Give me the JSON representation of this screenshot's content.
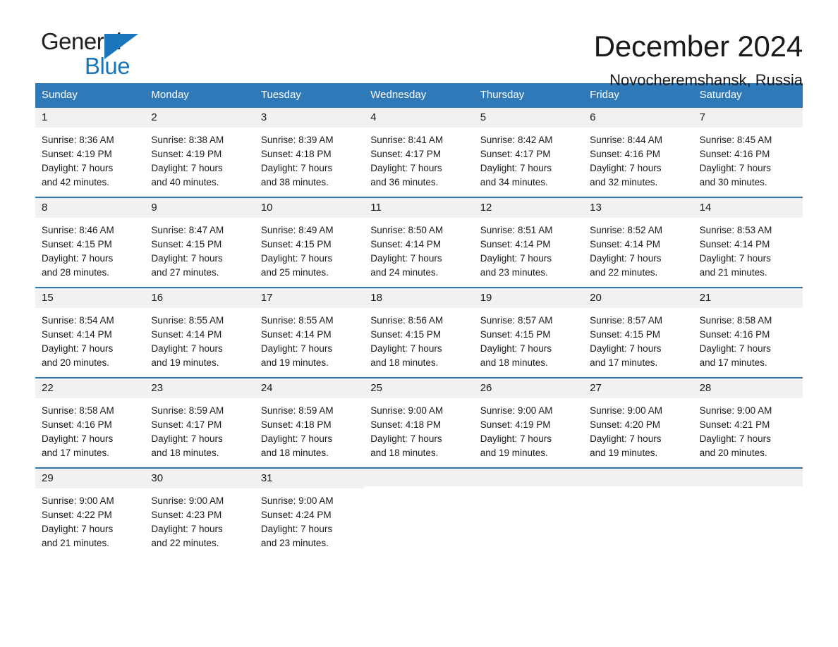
{
  "logo": {
    "word_one": "General",
    "word_two": "Blue",
    "triangle_icon": "triangle-icon",
    "brand_blue": "#1b75bb",
    "brand_dark": "#231f20"
  },
  "header": {
    "title": "December 2024",
    "location": "Novocheremshansk, Russia"
  },
  "theme": {
    "header_blue": "#3079b8",
    "row_divider_blue": "#2e75b6",
    "day_band_gray": "#f1f1f1",
    "text": "#1a1a1a"
  },
  "calendar": {
    "weekdays": [
      "Sunday",
      "Monday",
      "Tuesday",
      "Wednesday",
      "Thursday",
      "Friday",
      "Saturday"
    ],
    "weeks": [
      [
        {
          "day": "1",
          "sunrise": "Sunrise: 8:36 AM",
          "sunset": "Sunset: 4:19 PM",
          "daylight_line1": "Daylight: 7 hours",
          "daylight_line2": "and 42 minutes."
        },
        {
          "day": "2",
          "sunrise": "Sunrise: 8:38 AM",
          "sunset": "Sunset: 4:19 PM",
          "daylight_line1": "Daylight: 7 hours",
          "daylight_line2": "and 40 minutes."
        },
        {
          "day": "3",
          "sunrise": "Sunrise: 8:39 AM",
          "sunset": "Sunset: 4:18 PM",
          "daylight_line1": "Daylight: 7 hours",
          "daylight_line2": "and 38 minutes."
        },
        {
          "day": "4",
          "sunrise": "Sunrise: 8:41 AM",
          "sunset": "Sunset: 4:17 PM",
          "daylight_line1": "Daylight: 7 hours",
          "daylight_line2": "and 36 minutes."
        },
        {
          "day": "5",
          "sunrise": "Sunrise: 8:42 AM",
          "sunset": "Sunset: 4:17 PM",
          "daylight_line1": "Daylight: 7 hours",
          "daylight_line2": "and 34 minutes."
        },
        {
          "day": "6",
          "sunrise": "Sunrise: 8:44 AM",
          "sunset": "Sunset: 4:16 PM",
          "daylight_line1": "Daylight: 7 hours",
          "daylight_line2": "and 32 minutes."
        },
        {
          "day": "7",
          "sunrise": "Sunrise: 8:45 AM",
          "sunset": "Sunset: 4:16 PM",
          "daylight_line1": "Daylight: 7 hours",
          "daylight_line2": "and 30 minutes."
        }
      ],
      [
        {
          "day": "8",
          "sunrise": "Sunrise: 8:46 AM",
          "sunset": "Sunset: 4:15 PM",
          "daylight_line1": "Daylight: 7 hours",
          "daylight_line2": "and 28 minutes."
        },
        {
          "day": "9",
          "sunrise": "Sunrise: 8:47 AM",
          "sunset": "Sunset: 4:15 PM",
          "daylight_line1": "Daylight: 7 hours",
          "daylight_line2": "and 27 minutes."
        },
        {
          "day": "10",
          "sunrise": "Sunrise: 8:49 AM",
          "sunset": "Sunset: 4:15 PM",
          "daylight_line1": "Daylight: 7 hours",
          "daylight_line2": "and 25 minutes."
        },
        {
          "day": "11",
          "sunrise": "Sunrise: 8:50 AM",
          "sunset": "Sunset: 4:14 PM",
          "daylight_line1": "Daylight: 7 hours",
          "daylight_line2": "and 24 minutes."
        },
        {
          "day": "12",
          "sunrise": "Sunrise: 8:51 AM",
          "sunset": "Sunset: 4:14 PM",
          "daylight_line1": "Daylight: 7 hours",
          "daylight_line2": "and 23 minutes."
        },
        {
          "day": "13",
          "sunrise": "Sunrise: 8:52 AM",
          "sunset": "Sunset: 4:14 PM",
          "daylight_line1": "Daylight: 7 hours",
          "daylight_line2": "and 22 minutes."
        },
        {
          "day": "14",
          "sunrise": "Sunrise: 8:53 AM",
          "sunset": "Sunset: 4:14 PM",
          "daylight_line1": "Daylight: 7 hours",
          "daylight_line2": "and 21 minutes."
        }
      ],
      [
        {
          "day": "15",
          "sunrise": "Sunrise: 8:54 AM",
          "sunset": "Sunset: 4:14 PM",
          "daylight_line1": "Daylight: 7 hours",
          "daylight_line2": "and 20 minutes."
        },
        {
          "day": "16",
          "sunrise": "Sunrise: 8:55 AM",
          "sunset": "Sunset: 4:14 PM",
          "daylight_line1": "Daylight: 7 hours",
          "daylight_line2": "and 19 minutes."
        },
        {
          "day": "17",
          "sunrise": "Sunrise: 8:55 AM",
          "sunset": "Sunset: 4:14 PM",
          "daylight_line1": "Daylight: 7 hours",
          "daylight_line2": "and 19 minutes."
        },
        {
          "day": "18",
          "sunrise": "Sunrise: 8:56 AM",
          "sunset": "Sunset: 4:15 PM",
          "daylight_line1": "Daylight: 7 hours",
          "daylight_line2": "and 18 minutes."
        },
        {
          "day": "19",
          "sunrise": "Sunrise: 8:57 AM",
          "sunset": "Sunset: 4:15 PM",
          "daylight_line1": "Daylight: 7 hours",
          "daylight_line2": "and 18 minutes."
        },
        {
          "day": "20",
          "sunrise": "Sunrise: 8:57 AM",
          "sunset": "Sunset: 4:15 PM",
          "daylight_line1": "Daylight: 7 hours",
          "daylight_line2": "and 17 minutes."
        },
        {
          "day": "21",
          "sunrise": "Sunrise: 8:58 AM",
          "sunset": "Sunset: 4:16 PM",
          "daylight_line1": "Daylight: 7 hours",
          "daylight_line2": "and 17 minutes."
        }
      ],
      [
        {
          "day": "22",
          "sunrise": "Sunrise: 8:58 AM",
          "sunset": "Sunset: 4:16 PM",
          "daylight_line1": "Daylight: 7 hours",
          "daylight_line2": "and 17 minutes."
        },
        {
          "day": "23",
          "sunrise": "Sunrise: 8:59 AM",
          "sunset": "Sunset: 4:17 PM",
          "daylight_line1": "Daylight: 7 hours",
          "daylight_line2": "and 18 minutes."
        },
        {
          "day": "24",
          "sunrise": "Sunrise: 8:59 AM",
          "sunset": "Sunset: 4:18 PM",
          "daylight_line1": "Daylight: 7 hours",
          "daylight_line2": "and 18 minutes."
        },
        {
          "day": "25",
          "sunrise": "Sunrise: 9:00 AM",
          "sunset": "Sunset: 4:18 PM",
          "daylight_line1": "Daylight: 7 hours",
          "daylight_line2": "and 18 minutes."
        },
        {
          "day": "26",
          "sunrise": "Sunrise: 9:00 AM",
          "sunset": "Sunset: 4:19 PM",
          "daylight_line1": "Daylight: 7 hours",
          "daylight_line2": "and 19 minutes."
        },
        {
          "day": "27",
          "sunrise": "Sunrise: 9:00 AM",
          "sunset": "Sunset: 4:20 PM",
          "daylight_line1": "Daylight: 7 hours",
          "daylight_line2": "and 19 minutes."
        },
        {
          "day": "28",
          "sunrise": "Sunrise: 9:00 AM",
          "sunset": "Sunset: 4:21 PM",
          "daylight_line1": "Daylight: 7 hours",
          "daylight_line2": "and 20 minutes."
        }
      ],
      [
        {
          "day": "29",
          "sunrise": "Sunrise: 9:00 AM",
          "sunset": "Sunset: 4:22 PM",
          "daylight_line1": "Daylight: 7 hours",
          "daylight_line2": "and 21 minutes."
        },
        {
          "day": "30",
          "sunrise": "Sunrise: 9:00 AM",
          "sunset": "Sunset: 4:23 PM",
          "daylight_line1": "Daylight: 7 hours",
          "daylight_line2": "and 22 minutes."
        },
        {
          "day": "31",
          "sunrise": "Sunrise: 9:00 AM",
          "sunset": "Sunset: 4:24 PM",
          "daylight_line1": "Daylight: 7 hours",
          "daylight_line2": "and 23 minutes."
        },
        {
          "day": "",
          "sunrise": "",
          "sunset": "",
          "daylight_line1": "",
          "daylight_line2": ""
        },
        {
          "day": "",
          "sunrise": "",
          "sunset": "",
          "daylight_line1": "",
          "daylight_line2": ""
        },
        {
          "day": "",
          "sunrise": "",
          "sunset": "",
          "daylight_line1": "",
          "daylight_line2": ""
        },
        {
          "day": "",
          "sunrise": "",
          "sunset": "",
          "daylight_line1": "",
          "daylight_line2": ""
        }
      ]
    ]
  }
}
